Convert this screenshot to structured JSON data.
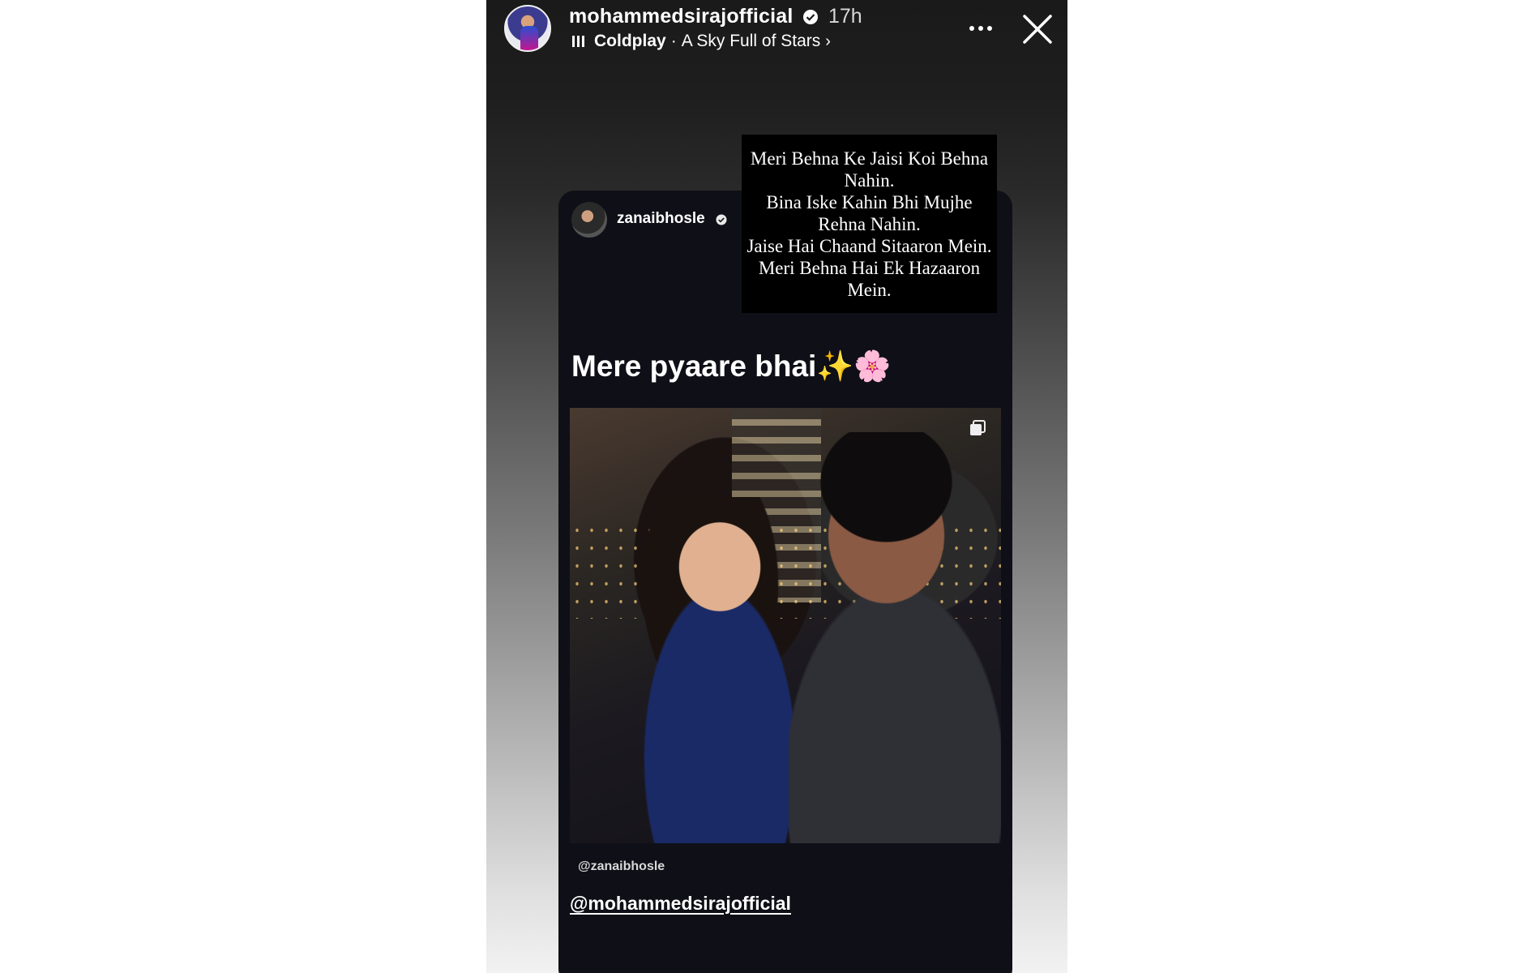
{
  "header": {
    "username": "mohammedsirajofficial",
    "time": "17h",
    "music": {
      "artist": "Coldplay",
      "separator": "·",
      "song": "A Sky Full of Stars",
      "chevron": "›"
    },
    "icons": {
      "verified": "verified-badge-icon",
      "more": "more-options-icon",
      "close": "close-icon"
    }
  },
  "shared_post": {
    "username": "zanaibhosle",
    "caption": "Mere pyaare bhai✨🌸",
    "photo_tag": "@zanaibhosle",
    "mention": "@mohammedsirajofficial",
    "icons": {
      "verified": "verified-badge-icon",
      "carousel": "multiple-photos-icon"
    }
  },
  "text_sticker": {
    "lines": [
      "Meri Behna Ke Jaisi Koi Behna Nahin.",
      "Bina Iske Kahin Bhi Mujhe Rehna Nahin.",
      "Jaise Hai Chaand Sitaaron Mein.",
      "Meri Behna Hai Ek Hazaaron Mein."
    ]
  }
}
